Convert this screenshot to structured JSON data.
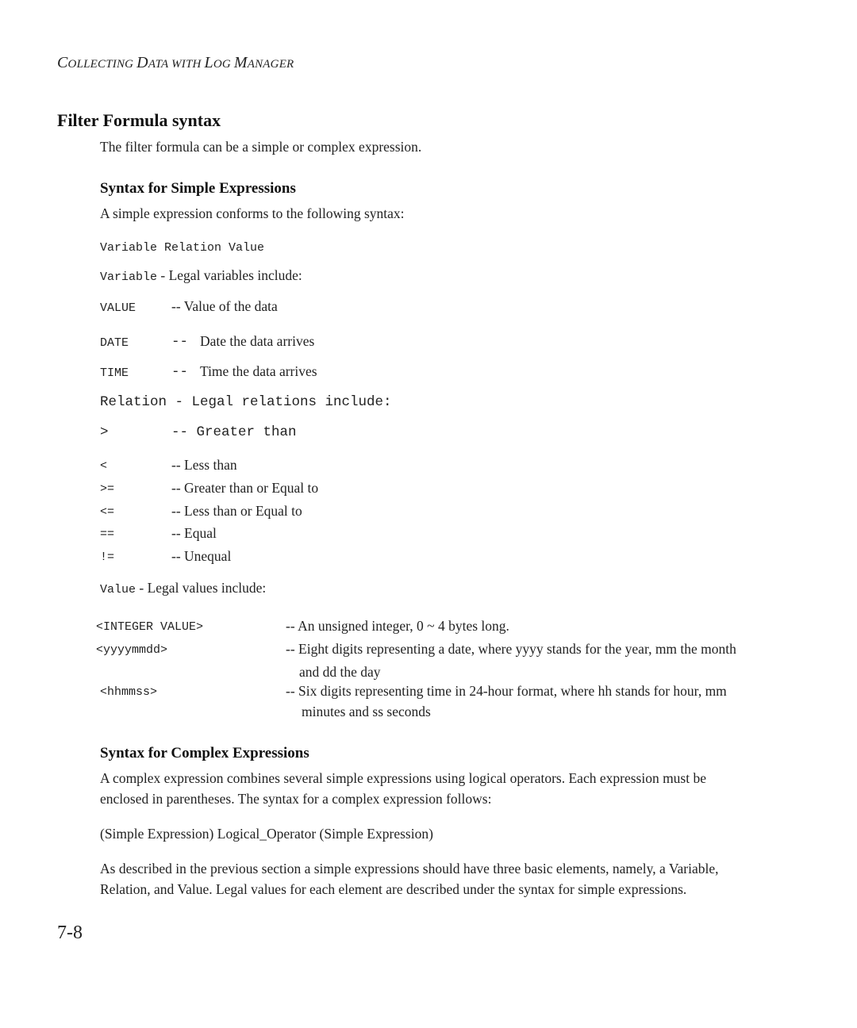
{
  "running_header": {
    "parts": [
      {
        "cap": "C",
        "rest": "OLLECTING "
      },
      {
        "cap": "D",
        "rest": "ATA WITH "
      },
      {
        "cap": "L",
        "rest": "OG "
      },
      {
        "cap": "M",
        "rest": "ANAGER"
      }
    ]
  },
  "section": {
    "title": "Filter Formula syntax",
    "intro": "The filter formula can be a simple or complex expression."
  },
  "simple": {
    "heading": "Syntax for Simple Expressions",
    "intro": "A simple expression conforms to the following syntax:",
    "syntax_line": "Variable Relation Value",
    "variable_label": "Variable",
    "variable_desc": " - Legal variables include:",
    "variables": [
      {
        "name": "VALUE",
        "desc": "-- Value of the data"
      },
      {
        "name": "DATE",
        "sep": "--",
        "desc": "Date the data arrives"
      },
      {
        "name": "TIME",
        "sep": "--",
        "desc": "Time the data arrives"
      }
    ],
    "relation_line": "Relation - Legal relations include:",
    "relation_first": {
      "op": ">",
      "desc": "-- Greater than"
    },
    "relations": [
      {
        "op": "<",
        "desc": "-- Less than"
      },
      {
        "op": ">=",
        "desc": "-- Greater than or Equal to"
      },
      {
        "op": "<=",
        "desc": "-- Less than or Equal to"
      },
      {
        "op": "==",
        "desc": "-- Equal"
      },
      {
        "op": "!=",
        "desc": "-- Unequal"
      }
    ],
    "value_label": "Value",
    "value_desc": " - Legal values include:",
    "values": [
      {
        "name": "<INTEGER VALUE>",
        "desc": "-- An unsigned integer, 0 ~ 4 bytes long.",
        "cont": ""
      },
      {
        "name": "<yyyymmdd>",
        "desc": "-- Eight digits representing a date, where yyyy stands for the year, mm the month",
        "cont": "and dd the day"
      },
      {
        "name": "<hhmmss>",
        "desc": "-- Six digits representing time in 24-hour format, where hh stands for hour, mm",
        "cont": "minutes and ss seconds"
      }
    ]
  },
  "complex": {
    "heading": "Syntax for Complex Expressions",
    "para1_line1": "A complex expression combines several simple expressions using logical operators. Each expression must be",
    "para1_line2": "enclosed in parentheses. The syntax for a complex expression follows:",
    "syntax": "(Simple Expression) Logical_Operator (Simple Expression)",
    "para2_line1": "As described in the previous section a simple expressions should have three basic elements, namely, a Variable,",
    "para2_line2": "Relation, and Value. Legal values for each element are described under the syntax for simple expressions."
  },
  "page_number": "7-8"
}
